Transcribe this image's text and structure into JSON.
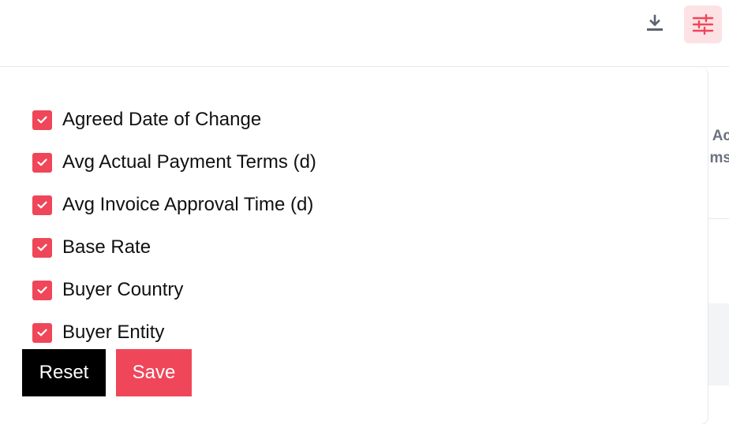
{
  "toolbar": {
    "download_icon": "download-icon",
    "columns_icon": "sliders-icon"
  },
  "background_table": {
    "header_partial_line1": "Ac",
    "header_partial_line2": "ms"
  },
  "column_picker": {
    "options": [
      {
        "label": "Agreed Date of Change",
        "checked": true
      },
      {
        "label": "Avg Actual Payment Terms (d)",
        "checked": true
      },
      {
        "label": "Avg Invoice Approval Time (d)",
        "checked": true
      },
      {
        "label": "Base Rate",
        "checked": true
      },
      {
        "label": "Buyer Country",
        "checked": true
      },
      {
        "label": "Buyer Entity",
        "checked": true
      }
    ],
    "reset_label": "Reset",
    "save_label": "Save"
  },
  "colors": {
    "accent": "#ef4659",
    "accent_light": "#fde2e5",
    "icon_gray": "#4b5563"
  }
}
